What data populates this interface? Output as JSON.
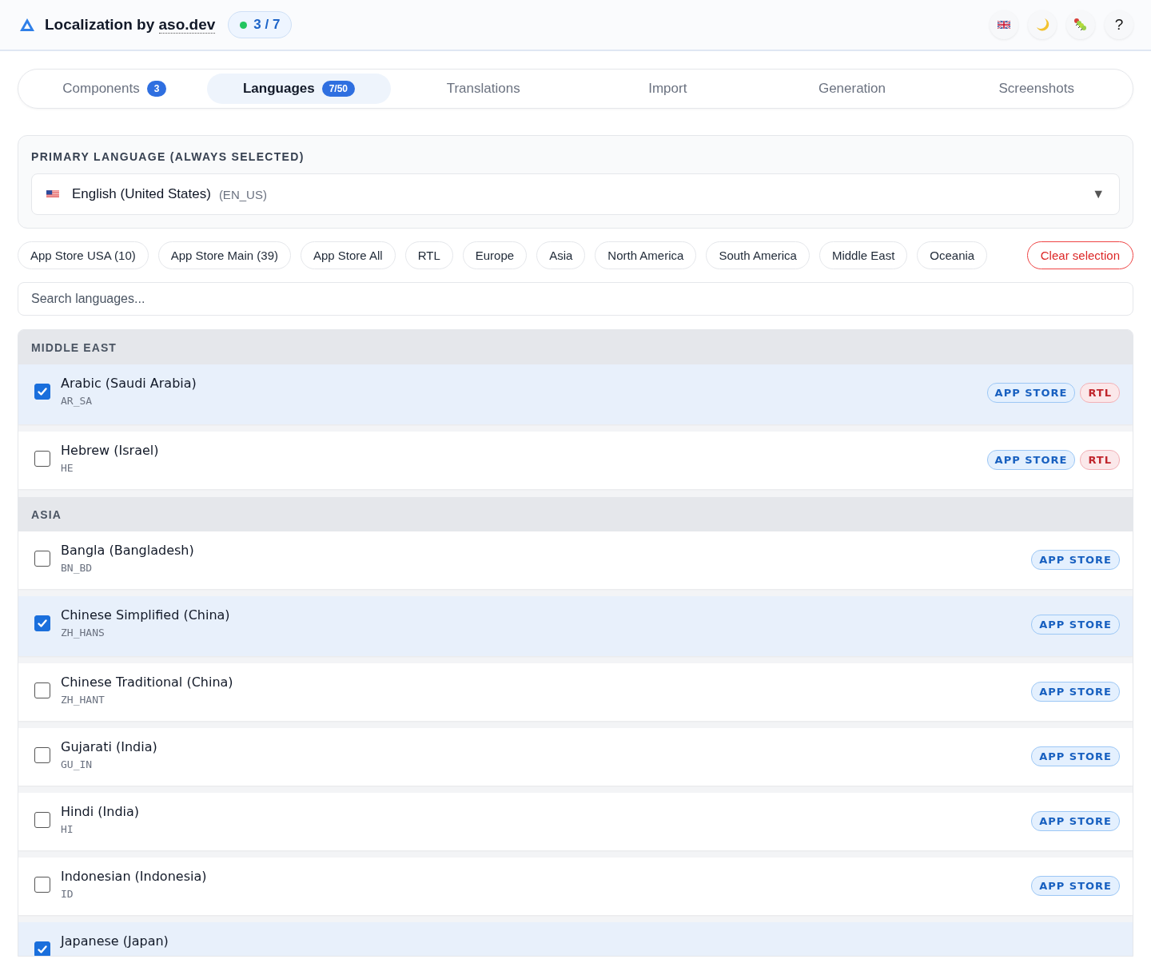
{
  "header": {
    "title": "Localization by ",
    "title_link": "aso.dev",
    "progress": "3 / 7",
    "icons": [
      {
        "kind": "flag_uk"
      },
      {
        "kind": "moon"
      },
      {
        "kind": "bug"
      },
      {
        "kind": "text",
        "text": "?"
      }
    ]
  },
  "tabs": [
    {
      "label": "Components",
      "badge": "3",
      "selected": false
    },
    {
      "label": "Languages",
      "badge": "7/50",
      "selected": true
    },
    {
      "label": "Translations",
      "selected": false
    },
    {
      "label": "Import",
      "selected": false
    },
    {
      "label": "Generation",
      "selected": false
    },
    {
      "label": "Screenshots",
      "selected": false
    }
  ],
  "primary": {
    "heading": "PRIMARY LANGUAGE (ALWAYS SELECTED)",
    "name": "English (United States)",
    "code": "(EN_US)",
    "caret": "▼"
  },
  "presets": [
    "App Store USA (10)",
    "App Store Main (39)",
    "App Store All",
    "RTL",
    "Europe",
    "Asia",
    "North America",
    "South America",
    "Middle East",
    "Oceania"
  ],
  "clear_button": "Clear selection",
  "search": {
    "placeholder": "Search languages..."
  },
  "groups": [
    {
      "title": "MIDDLE EAST",
      "languages": [
        {
          "name": "Arabic (Saudi Arabia)",
          "code": "AR_SA",
          "selected": true,
          "tags": [
            {
              "kind": "store",
              "label": "APP STORE"
            },
            {
              "kind": "rtl",
              "label": "RTL"
            }
          ]
        },
        {
          "name": "Hebrew (Israel)",
          "code": "HE",
          "selected": false,
          "tags": [
            {
              "kind": "store",
              "label": "APP STORE"
            },
            {
              "kind": "rtl",
              "label": "RTL"
            }
          ]
        }
      ]
    },
    {
      "title": "ASIA",
      "languages": [
        {
          "name": "Bangla (Bangladesh)",
          "code": "BN_BD",
          "selected": false,
          "tags": [
            {
              "kind": "store",
              "label": "APP STORE"
            }
          ]
        },
        {
          "name": "Chinese Simplified (China)",
          "code": "ZH_HANS",
          "selected": true,
          "tags": [
            {
              "kind": "store",
              "label": "APP STORE"
            }
          ]
        },
        {
          "name": "Chinese Traditional (China)",
          "code": "ZH_HANT",
          "selected": false,
          "tags": [
            {
              "kind": "store",
              "label": "APP STORE"
            }
          ]
        },
        {
          "name": "Gujarati (India)",
          "code": "GU_IN",
          "selected": false,
          "tags": [
            {
              "kind": "store",
              "label": "APP STORE"
            }
          ]
        },
        {
          "name": "Hindi (India)",
          "code": "HI",
          "selected": false,
          "tags": [
            {
              "kind": "store",
              "label": "APP STORE"
            }
          ]
        },
        {
          "name": "Indonesian (Indonesia)",
          "code": "ID",
          "selected": false,
          "tags": [
            {
              "kind": "store",
              "label": "APP STORE"
            }
          ]
        },
        {
          "name": "Japanese (Japan)",
          "selected": true
        }
      ]
    }
  ]
}
